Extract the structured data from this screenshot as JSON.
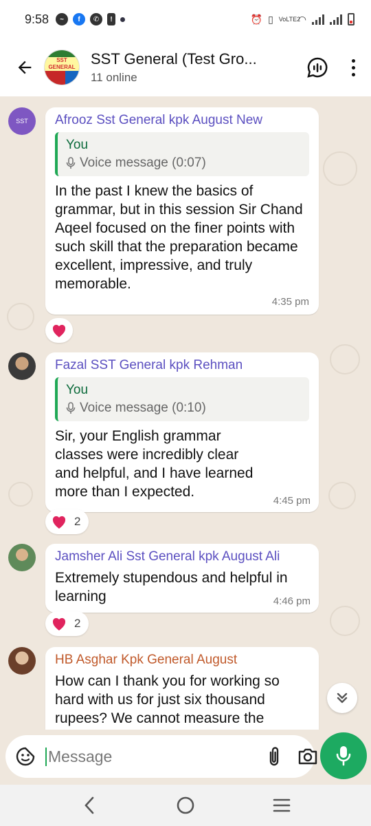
{
  "status_bar": {
    "time": "9:58",
    "network_label": "VoLTE2"
  },
  "header": {
    "title": "SST General (Test Gro...",
    "subtitle": "11 online",
    "avatar_text": "SST GENERAL"
  },
  "messages": [
    {
      "sender": "Afrooz Sst General kpk August New",
      "avatar_text": "SST",
      "quote": {
        "author": "You",
        "text": "Voice message (0:07)"
      },
      "text": "In the past I knew the basics of grammar, but in this session Sir Chand Aqeel focused on the finer points with such skill that the preparation became excellent, impressive, and truly memorable.",
      "time": "4:35 pm",
      "reaction": {
        "emoji": "heart",
        "count": ""
      }
    },
    {
      "sender": "Fazal SST General kpk Rehman",
      "quote": {
        "author": "You",
        "text": "Voice message (0:10)"
      },
      "text": "Sir, your English grammar classes were incredibly clear and helpful, and I have learned more than I expected.",
      "time": "4:45 pm",
      "reaction": {
        "emoji": "heart",
        "count": "2"
      }
    },
    {
      "sender": "Jamsher Ali Sst General kpk August Ali",
      "text": "Extremely stupendous and helpful in learning",
      "time": "4:46 pm",
      "reaction": {
        "emoji": "heart",
        "count": "2"
      }
    },
    {
      "sender": "HB Asghar Kpk General August",
      "text": "How can I thank you for working so hard with us for just six thousand rupees? We cannot measure the"
    }
  ],
  "input": {
    "placeholder": "Message"
  },
  "colors": {
    "accent_green": "#1daa61",
    "sender_purple": "#5b4fc0",
    "sender_orange": "#c0592a",
    "wallpaper": "#efe7dd",
    "heart": "#e0245e"
  }
}
